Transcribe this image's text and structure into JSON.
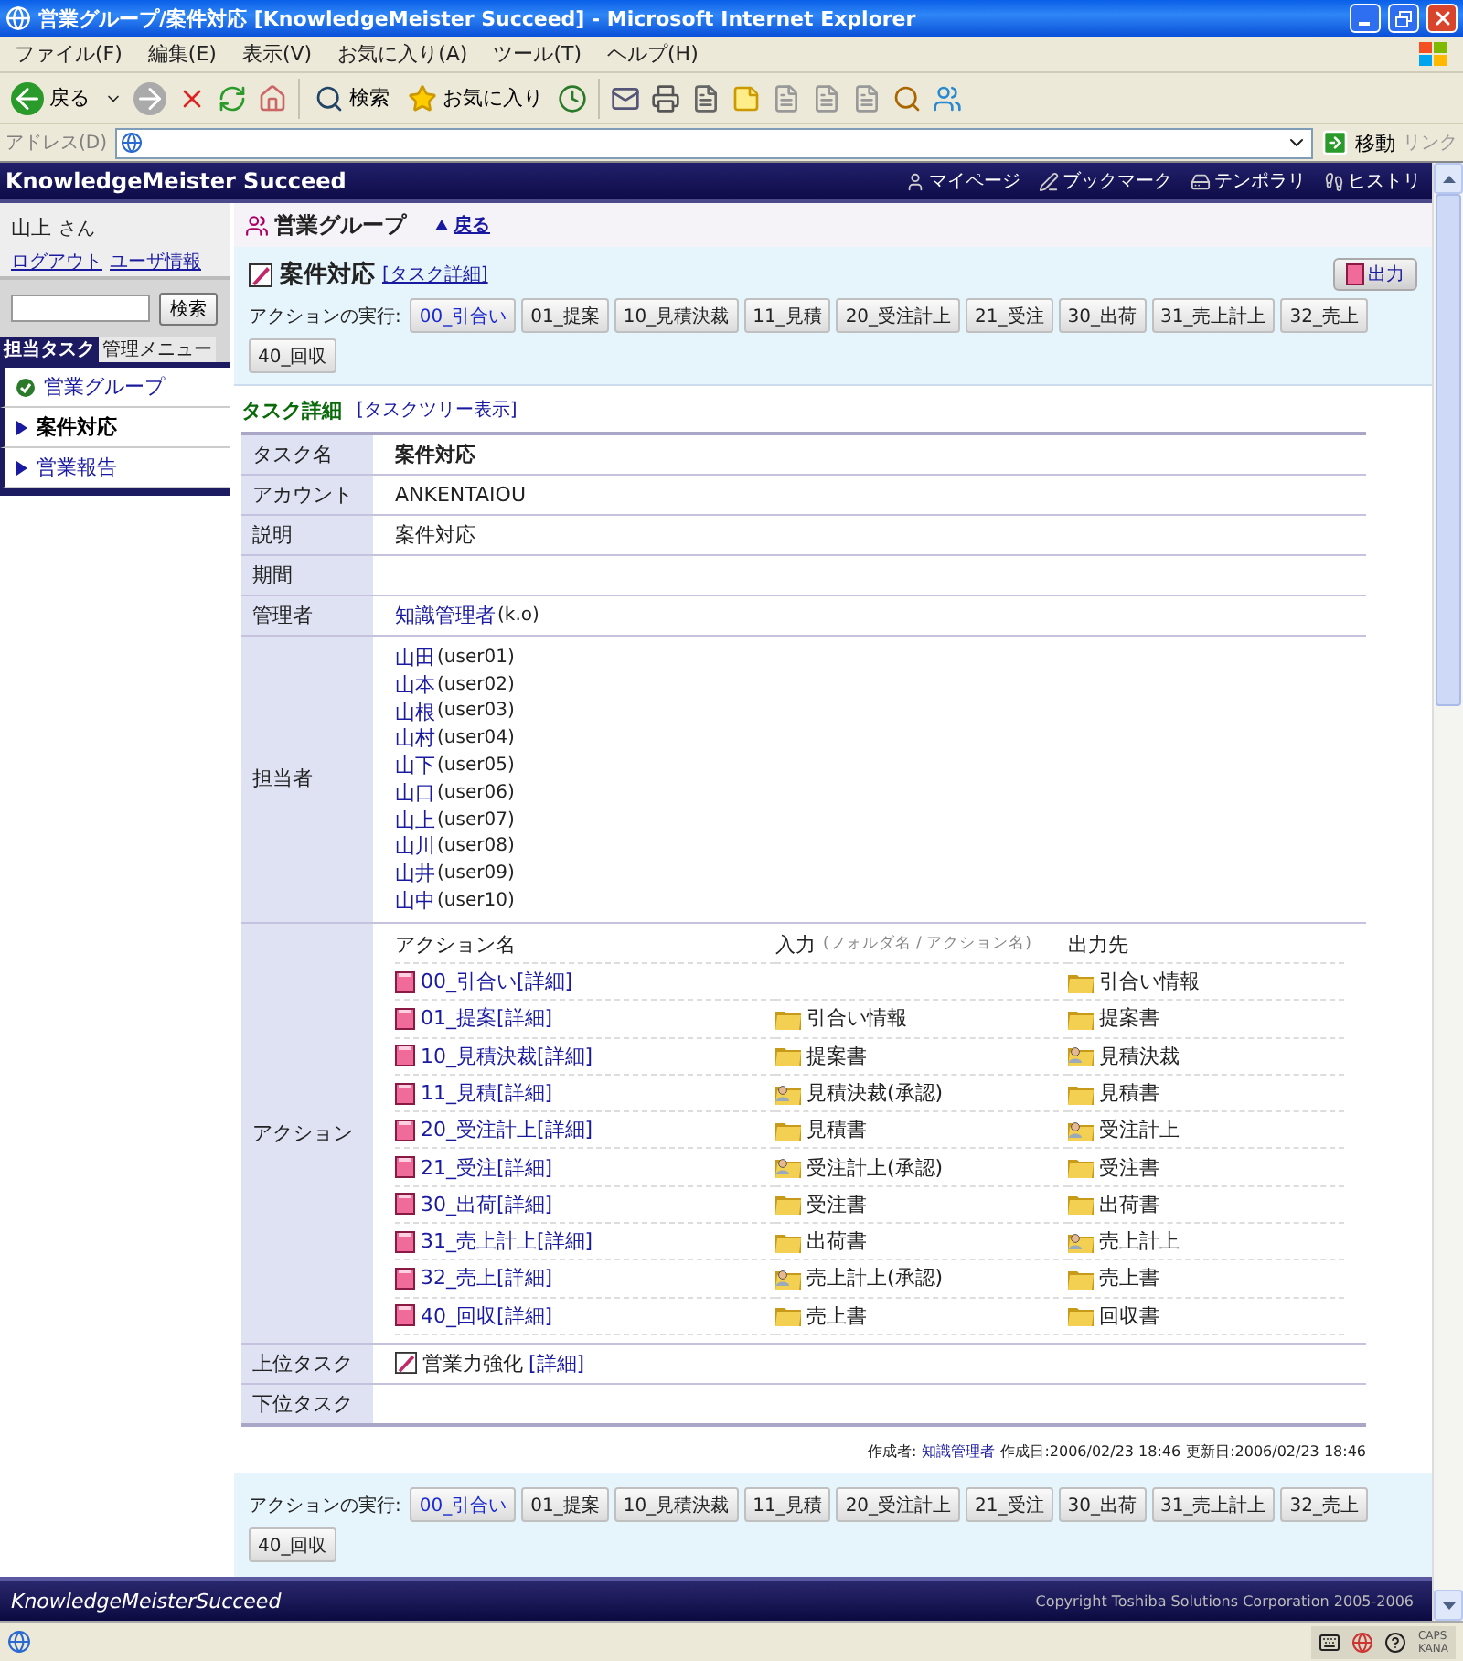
{
  "window": {
    "title": "営業グループ/案件対応 [KnowledgeMeister Succeed] - Microsoft Internet Explorer"
  },
  "menu": [
    "ファイル(F)",
    "編集(E)",
    "表示(V)",
    "お気に入り(A)",
    "ツール(T)",
    "ヘルプ(H)"
  ],
  "toolbar": {
    "back": "戻る",
    "search": "検索",
    "favorites": "お気に入り"
  },
  "address": {
    "label": "アドレス(D)",
    "go": "移動",
    "links": "リンク"
  },
  "header": {
    "brand": "KnowledgeMeister Succeed",
    "links": [
      {
        "label": "マイページ",
        "kind": "mypage"
      },
      {
        "label": "ブックマーク",
        "kind": "bookmark"
      },
      {
        "label": "テンポラリ",
        "kind": "temporary"
      },
      {
        "label": "ヒストリ",
        "kind": "history"
      }
    ]
  },
  "user": {
    "name": "山上",
    "suffix": "さん",
    "logout": "ログアウト",
    "info": "ユーザ情報"
  },
  "search": {
    "button": "検索"
  },
  "side_tabs": [
    {
      "label": "担当タスク",
      "selected": true
    },
    {
      "label": "管理メニュー",
      "selected": false
    }
  ],
  "side_items": [
    {
      "label": "営業グループ",
      "kind": "group",
      "selected": false
    },
    {
      "label": "案件対応",
      "kind": "task",
      "selected": true
    },
    {
      "label": "営業報告",
      "kind": "task",
      "selected": false
    }
  ],
  "group": {
    "title": "営業グループ",
    "back": "戻る"
  },
  "task": {
    "title": "案件対応",
    "detail_link": "[タスク詳細]",
    "export": "出力"
  },
  "action_bar": {
    "label": "アクションの実行:",
    "buttons": [
      {
        "label": "00_引合い",
        "selected": true
      },
      {
        "label": "01_提案",
        "selected": false
      },
      {
        "label": "10_見積決裁",
        "selected": false
      },
      {
        "label": "11_見積",
        "selected": false
      },
      {
        "label": "20_受注計上",
        "selected": false
      },
      {
        "label": "21_受注",
        "selected": false
      },
      {
        "label": "30_出荷",
        "selected": false
      },
      {
        "label": "31_売上計上",
        "selected": false
      },
      {
        "label": "32_売上",
        "selected": false
      },
      {
        "label": "40_回収",
        "selected": false
      }
    ]
  },
  "detail": {
    "title": "タスク詳細",
    "tree_link": "[タスクツリー表示]",
    "rows": [
      {
        "label": "タスク名",
        "kind": "text",
        "value": "案件対応",
        "bold": true
      },
      {
        "label": "アカウント",
        "kind": "text",
        "value": "ANKENTAIOU",
        "bold": false
      },
      {
        "label": "説明",
        "kind": "text",
        "value": "案件対応",
        "bold": false
      },
      {
        "label": "期間",
        "kind": "empty"
      },
      {
        "label": "管理者",
        "kind": "person",
        "name": "知識管理者",
        "id": "(k.o)"
      },
      {
        "label": "担当者",
        "kind": "users",
        "users": [
          {
            "name": "山田",
            "id": "(user01)"
          },
          {
            "name": "山本",
            "id": "(user02)"
          },
          {
            "name": "山根",
            "id": "(user03)"
          },
          {
            "name": "山村",
            "id": "(user04)"
          },
          {
            "name": "山下",
            "id": "(user05)"
          },
          {
            "name": "山口",
            "id": "(user06)"
          },
          {
            "name": "山上",
            "id": "(user07)"
          },
          {
            "name": "山川",
            "id": "(user08)"
          },
          {
            "name": "山井",
            "id": "(user09)"
          },
          {
            "name": "山中",
            "id": "(user10)"
          }
        ]
      },
      {
        "label": "アクション",
        "kind": "actions",
        "columns": {
          "name": "アクション名",
          "input": "入力",
          "input_hint": "(フォルダ名 / アクション名)",
          "output": "出力先"
        },
        "items": [
          {
            "name": "00_引合い",
            "detail": "[詳細]",
            "output": {
              "label": "引合い情報",
              "kind": "folder"
            }
          },
          {
            "name": "01_提案",
            "detail": "[詳細]",
            "input": {
              "label": "引合い情報",
              "kind": "folder"
            },
            "output": {
              "label": "提案書",
              "kind": "folder"
            }
          },
          {
            "name": "10_見積決裁",
            "detail": "[詳細]",
            "input": {
              "label": "提案書",
              "kind": "folder"
            },
            "output": {
              "label": "見積決裁",
              "kind": "approval"
            }
          },
          {
            "name": "11_見積",
            "detail": "[詳細]",
            "input": {
              "label": "見積決裁(承認)",
              "kind": "approval"
            },
            "output": {
              "label": "見積書",
              "kind": "folder"
            }
          },
          {
            "name": "20_受注計上",
            "detail": "[詳細]",
            "input": {
              "label": "見積書",
              "kind": "folder"
            },
            "output": {
              "label": "受注計上",
              "kind": "approval"
            }
          },
          {
            "name": "21_受注",
            "detail": "[詳細]",
            "input": {
              "label": "受注計上(承認)",
              "kind": "approval"
            },
            "output": {
              "label": "受注書",
              "kind": "folder"
            }
          },
          {
            "name": "30_出荷",
            "detail": "[詳細]",
            "input": {
              "label": "受注書",
              "kind": "folder"
            },
            "output": {
              "label": "出荷書",
              "kind": "folder"
            }
          },
          {
            "name": "31_売上計上",
            "detail": "[詳細]",
            "input": {
              "label": "出荷書",
              "kind": "folder"
            },
            "output": {
              "label": "売上計上",
              "kind": "approval"
            }
          },
          {
            "name": "32_売上",
            "detail": "[詳細]",
            "input": {
              "label": "売上計上(承認)",
              "kind": "approval"
            },
            "output": {
              "label": "売上書",
              "kind": "folder"
            }
          },
          {
            "name": "40_回収",
            "detail": "[詳細]",
            "input": {
              "label": "売上書",
              "kind": "folder"
            },
            "output": {
              "label": "回収書",
              "kind": "folder"
            }
          }
        ]
      },
      {
        "label": "上位タスク",
        "kind": "task",
        "name": "営業力強化",
        "detail": "[詳細]"
      },
      {
        "label": "下位タスク",
        "kind": "empty"
      }
    ]
  },
  "meta": {
    "creator_label": "作成者:",
    "creator": "知識管理者",
    "created": "作成日:2006/02/23 18:46",
    "updated": "更新日:2006/02/23 18:46"
  },
  "bottom_action_bar": {
    "label": "アクションの実行:",
    "buttons": [
      {
        "label": "00_引合い",
        "selected": true
      },
      {
        "label": "01_提案",
        "selected": false
      },
      {
        "label": "10_見積決裁",
        "selected": false
      },
      {
        "label": "11_見積",
        "selected": false
      },
      {
        "label": "20_受注計上",
        "selected": false
      },
      {
        "label": "21_受注",
        "selected": false
      },
      {
        "label": "30_出荷",
        "selected": false
      },
      {
        "label": "31_売上計上",
        "selected": false
      },
      {
        "label": "32_売上",
        "selected": false
      },
      {
        "label": "40_回収",
        "selected": false
      }
    ]
  },
  "footer": {
    "logo": "KnowledgeMeisterSucceed",
    "copyright": "Copyright Toshiba Solutions Corporation 2005-2006"
  },
  "status_bar": {
    "ime": [
      "CAPS",
      "KANA"
    ]
  }
}
